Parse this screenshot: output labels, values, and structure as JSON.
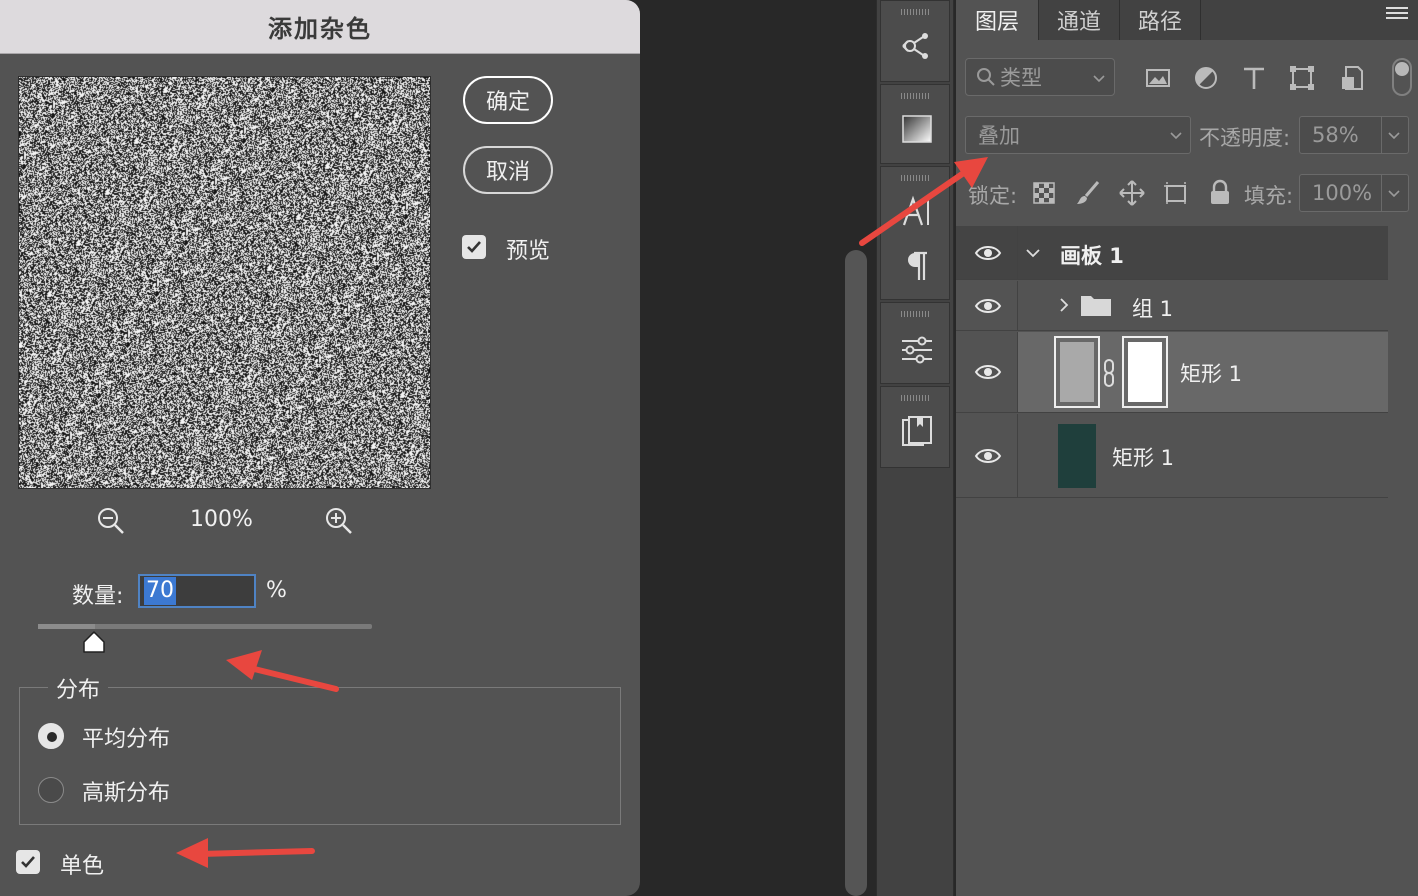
{
  "dialog": {
    "title": "添加杂色",
    "ok_label": "确定",
    "cancel_label": "取消",
    "preview_label": "预览",
    "preview_checked": true,
    "zoom_level": "100%",
    "amount_label": "数量:",
    "amount_value": "70",
    "amount_unit": "%",
    "amount_slider_percent": 17,
    "distribution": {
      "legend": "分布",
      "options": [
        {
          "label": "平均分布",
          "selected": true
        },
        {
          "label": "高斯分布",
          "selected": false
        }
      ]
    },
    "monochrome_label": "单色",
    "monochrome_checked": true
  },
  "layers_panel": {
    "tabs": [
      "图层",
      "通道",
      "路径"
    ],
    "active_tab": 0,
    "filter_placeholder": "类型",
    "blend_mode": "叠加",
    "opacity_label": "不透明度:",
    "opacity_value": "58%",
    "lock_label": "锁定:",
    "fill_label": "填充:",
    "fill_value": "100%",
    "layers": [
      {
        "name": "画板 1",
        "kind": "artboard",
        "expanded": true
      },
      {
        "name": "组 1",
        "kind": "group",
        "expanded": false
      },
      {
        "name": "矩形 1",
        "kind": "shape-with-mask",
        "selected": true,
        "thumb_color": "#a9a9a9"
      },
      {
        "name": "矩形 1",
        "kind": "shape",
        "selected": false,
        "thumb_color": "#1f3f3c"
      }
    ]
  },
  "colors": {
    "dialog_bg": "#535353",
    "title_bar": "#dddadd",
    "panel_bg": "#535353",
    "selection_blue": "#3c79d2",
    "annotation_red": "#e8473f"
  }
}
